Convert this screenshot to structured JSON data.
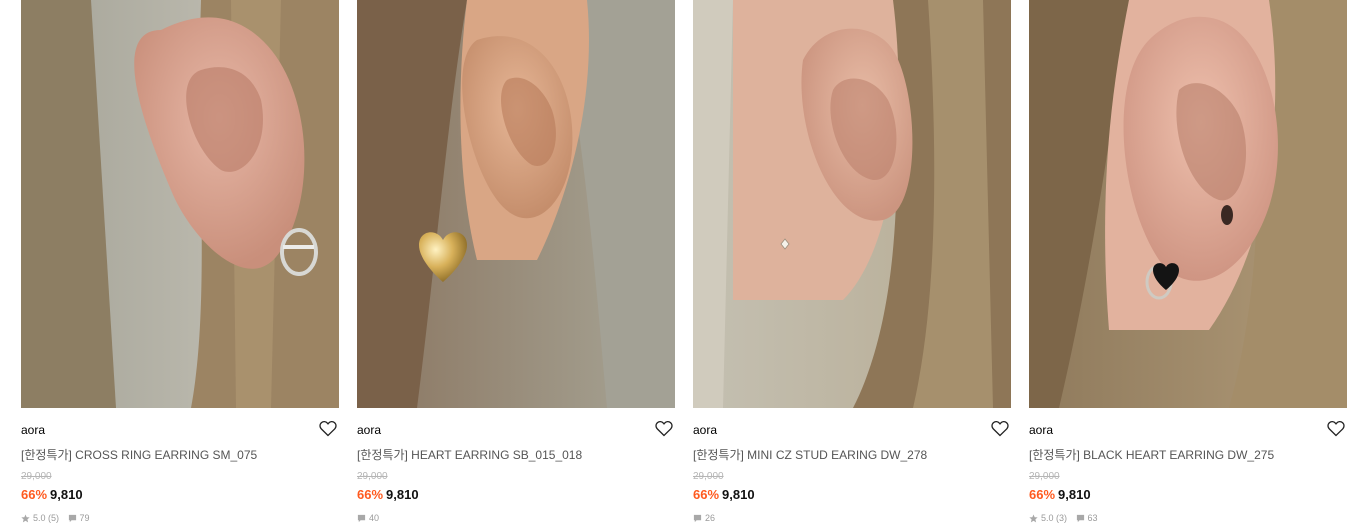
{
  "colors": {
    "discount": "#ff5a1f",
    "price": "#111111",
    "original_price": "#b5b5b5",
    "meta": "#9a9a9a"
  },
  "products": [
    {
      "image": "ear-with-silver-cross-ring-hoop",
      "brand": "aora",
      "name": "[한정특가] CROSS RING EARRING SM_075",
      "original_price": "29,000",
      "discount": "66%",
      "price": "9,810",
      "rating": "5.0 (5)",
      "reviews": "79",
      "wish_icon": "heart-outline-icon"
    },
    {
      "image": "ear-with-gold-heart-stud",
      "brand": "aora",
      "name": "[한정특가] HEART EARRING SB_015_018",
      "original_price": "29,000",
      "discount": "66%",
      "price": "9,810",
      "rating": "",
      "reviews": "40",
      "wish_icon": "heart-outline-icon"
    },
    {
      "image": "ear-with-mini-cz-stud",
      "brand": "aora",
      "name": "[한정특가] MINI CZ STUD EARING DW_278",
      "original_price": "29,000",
      "discount": "66%",
      "price": "9,810",
      "rating": "",
      "reviews": "26",
      "wish_icon": "heart-outline-icon"
    },
    {
      "image": "ear-with-black-heart-hoop",
      "brand": "aora",
      "name": "[한정특가] BLACK HEART EARRING DW_275",
      "original_price": "29,000",
      "discount": "66%",
      "price": "9,810",
      "rating": "5.0 (3)",
      "reviews": "63",
      "wish_icon": "heart-outline-icon"
    }
  ]
}
